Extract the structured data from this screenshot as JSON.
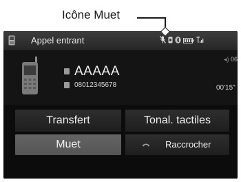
{
  "callout": {
    "label": "Icône Muet"
  },
  "status_bar": {
    "title": "Appel entrant",
    "icons": [
      "mic-muted-icon",
      "sim-icon",
      "bluetooth-icon",
      "battery-icon",
      "signal-icon"
    ]
  },
  "call": {
    "caller_name": "AAAAA",
    "caller_number": "08012345678",
    "signal_label": "06",
    "duration": "00'15\""
  },
  "buttons": {
    "transfer": "Transfert",
    "touch_tones": "Tonal. tactiles",
    "mute": "Muet",
    "hang_up": "Raccrocher"
  },
  "colors": {
    "screen_bg": "#0e0e0e",
    "button_bg": "#2a2a2a",
    "button_active_bg": "#5e5e5e",
    "text": "#f0f0f0"
  }
}
